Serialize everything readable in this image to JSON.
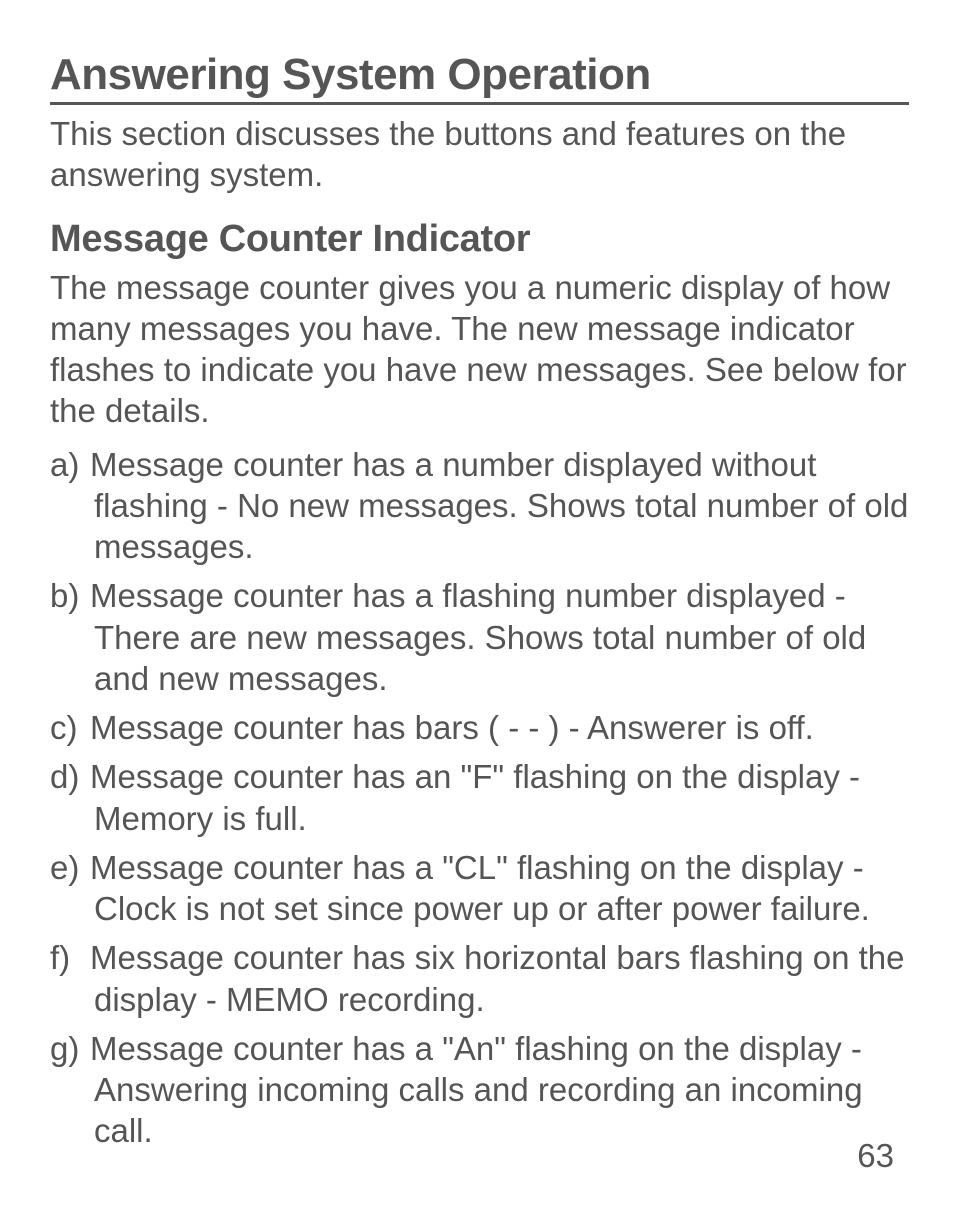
{
  "heading": "Answering System Operation",
  "intro": "This section discusses the buttons and features on the answering system.",
  "subheading": "Message Counter Indicator",
  "subintro": "The message counter gives you a numeric display of how many messages you have. The new message indicator flashes to indicate you have new messages. See below for the details.",
  "items": [
    {
      "marker": "a)",
      "text": "Message counter has a number displayed without flashing - No new messages. Shows total number of old messages."
    },
    {
      "marker": "b)",
      "text": "Message counter has a flashing number displayed - There are new messages. Shows total number of old and new messages."
    },
    {
      "marker": "c)",
      "text": "Message counter has bars ( - - ) - Answerer is off."
    },
    {
      "marker": "d)",
      "text": "Message counter has an \"F\" flashing on the display - Memory is full."
    },
    {
      "marker": "e)",
      "text": "Message counter has a \"CL\" flashing on the display - Clock is not set since power up or after power failure."
    },
    {
      "marker": "f)",
      "text": "Message counter has six horizontal bars flashing on the display - MEMO recording."
    },
    {
      "marker": "g)",
      "text": "Message counter has a \"An\" flashing on the display - Answering incoming calls and recording an incoming call."
    }
  ],
  "page_number": "63"
}
